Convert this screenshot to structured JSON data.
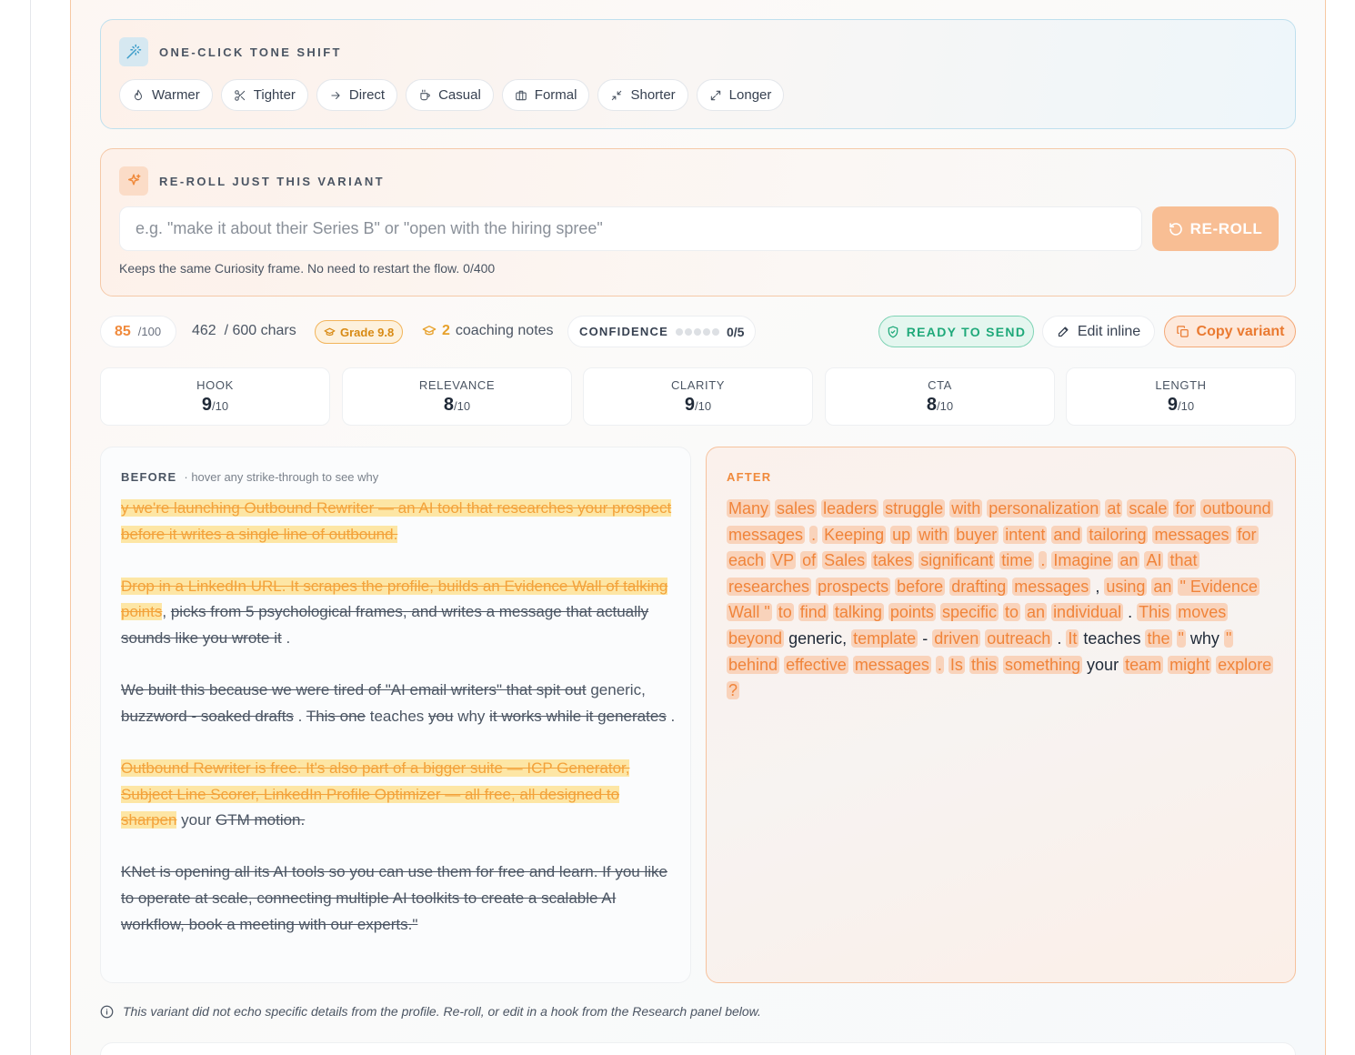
{
  "tone": {
    "title": "ONE-CLICK TONE SHIFT",
    "chips": [
      {
        "label": "Warmer",
        "icon": "flame-icon"
      },
      {
        "label": "Tighter",
        "icon": "scissors-icon"
      },
      {
        "label": "Direct",
        "icon": "arrow-right-icon"
      },
      {
        "label": "Casual",
        "icon": "coffee-icon"
      },
      {
        "label": "Formal",
        "icon": "briefcase-icon"
      },
      {
        "label": "Shorter",
        "icon": "minimize-icon"
      },
      {
        "label": "Longer",
        "icon": "maximize-icon"
      }
    ]
  },
  "reroll": {
    "title": "RE-ROLL JUST THIS VARIANT",
    "placeholder": "e.g. \"make it about their Series B\" or \"open with the hiring spree\"",
    "button": "RE-ROLL",
    "hint": "Keeps the same Curiosity frame. No need to restart the flow. 0/400"
  },
  "stats": {
    "score": "85",
    "score_max": "/100",
    "chars": "462  / 600 chars",
    "grade": "Grade 9.8",
    "coaching_count": "2",
    "coaching_label": "coaching notes",
    "confidence_label": "CONFIDENCE",
    "confidence_value": "0/5",
    "ready": "READY TO SEND",
    "edit": "Edit inline",
    "copy": "Copy variant"
  },
  "metrics": [
    {
      "label": "HOOK",
      "value": "9",
      "max": "/10"
    },
    {
      "label": "RELEVANCE",
      "value": "8",
      "max": "/10"
    },
    {
      "label": "CLARITY",
      "value": "9",
      "max": "/10"
    },
    {
      "label": "CTA",
      "value": "8",
      "max": "/10"
    },
    {
      "label": "LENGTH",
      "value": "9",
      "max": "/10"
    }
  ],
  "before": {
    "title": "BEFORE",
    "subtitle": "· hover any strike-through to see why",
    "p1_hl": "y we're launching Outbound Rewriter — an AI tool that researches your prospect before it writes a single line of outbound.",
    "p2_hl": "Drop in a LinkedIn URL. It scrapes the profile, builds an Evidence Wall of talking points",
    "p2_rest_a": ",",
    "p2_del": "picks from 5 psychological frames, and writes a message that actually sounds like you wrote it",
    "p2_rest_b": ".",
    "p3_del_a": "We built this because we were tired of \"AI email writers\" that spit out",
    "p3_plain_a": "generic,",
    "p3_del_b": "buzzword - soaked drafts",
    "p3_plain_b": ".",
    "p3_del_c": "This one",
    "p3_plain_c": "teaches",
    "p3_del_d": "you",
    "p3_plain_d": "why",
    "p3_del_e": "it works while it generates",
    "p3_plain_e": ".",
    "p4_hl": "Outbound Rewriter is free. It's also part of a bigger suite — ICP Generator, Subject Line Scorer, LinkedIn Profile Optimizer — all free, all designed to sharpen",
    "p4_plain": "your",
    "p4_del": "GTM motion.",
    "p5_del": "KNet is opening all its AI tools so you can use them for free and learn. If you like to operate at scale, connecting multiple AI toolkits to create a scalable AI workflow, book a meeting with our experts.\""
  },
  "after": {
    "title": "AFTER",
    "tokens": [
      {
        "t": "Many",
        "h": true
      },
      {
        "t": "sales",
        "h": true
      },
      {
        "t": "leaders",
        "h": true
      },
      {
        "t": "struggle",
        "h": true
      },
      {
        "t": "with",
        "h": true
      },
      {
        "t": "personalization",
        "h": true
      },
      {
        "t": "at",
        "h": true
      },
      {
        "t": "scale",
        "h": true
      },
      {
        "t": "for",
        "h": true
      },
      {
        "t": "outbound",
        "h": true
      },
      {
        "t": "messages",
        "h": true
      },
      {
        "t": ".",
        "h": true
      },
      {
        "t": "Keeping",
        "h": true
      },
      {
        "t": "up",
        "h": true
      },
      {
        "t": "with",
        "h": true
      },
      {
        "t": "buyer",
        "h": true
      },
      {
        "t": "intent",
        "h": true
      },
      {
        "t": "and",
        "h": true
      },
      {
        "t": "tailoring",
        "h": true
      },
      {
        "t": "messages",
        "h": true
      },
      {
        "t": "for",
        "h": true
      },
      {
        "t": "each",
        "h": true
      },
      {
        "t": "VP",
        "h": true
      },
      {
        "t": "of",
        "h": true
      },
      {
        "t": "Sales",
        "h": true
      },
      {
        "t": "takes",
        "h": true
      },
      {
        "t": "significant",
        "h": true
      },
      {
        "t": "time",
        "h": true
      },
      {
        "t": ".",
        "h": true
      },
      {
        "t": "Imagine",
        "h": true
      },
      {
        "t": "an",
        "h": true
      },
      {
        "t": "AI",
        "h": true
      },
      {
        "t": "that",
        "h": true
      },
      {
        "t": "researches",
        "h": true
      },
      {
        "t": "prospects",
        "h": true
      },
      {
        "t": "before",
        "h": true
      },
      {
        "t": "drafting",
        "h": true
      },
      {
        "t": "messages",
        "h": true
      },
      {
        "t": ",",
        "h": false
      },
      {
        "t": "using",
        "h": true
      },
      {
        "t": "an",
        "h": true
      },
      {
        "t": "\" Evidence",
        "h": true
      },
      {
        "t": "Wall \"",
        "h": true
      },
      {
        "t": "to",
        "h": true
      },
      {
        "t": "find",
        "h": true
      },
      {
        "t": "talking",
        "h": true
      },
      {
        "t": "points",
        "h": true
      },
      {
        "t": "specific",
        "h": true
      },
      {
        "t": "to",
        "h": true
      },
      {
        "t": "an",
        "h": true
      },
      {
        "t": "individual",
        "h": true
      },
      {
        "t": ".",
        "h": false
      },
      {
        "t": "This",
        "h": true
      },
      {
        "t": "moves",
        "h": true
      },
      {
        "t": "beyond",
        "h": true
      },
      {
        "t": "generic,",
        "h": false
      },
      {
        "t": "template",
        "h": true
      },
      {
        "t": "-",
        "h": false
      },
      {
        "t": "driven",
        "h": true
      },
      {
        "t": "outreach",
        "h": true
      },
      {
        "t": ".",
        "h": false
      },
      {
        "t": "It",
        "h": true
      },
      {
        "t": "teaches",
        "h": false
      },
      {
        "t": "the",
        "h": true
      },
      {
        "t": "\"",
        "h": true
      },
      {
        "t": "why",
        "h": false
      },
      {
        "t": "\"",
        "h": true
      },
      {
        "t": "behind",
        "h": true
      },
      {
        "t": "effective",
        "h": true
      },
      {
        "t": "messages",
        "h": true
      },
      {
        "t": ".",
        "h": true
      },
      {
        "t": "Is",
        "h": true
      },
      {
        "t": "this",
        "h": true
      },
      {
        "t": "something",
        "h": true
      },
      {
        "t": "your",
        "h": false
      },
      {
        "t": "team",
        "h": true
      },
      {
        "t": "might",
        "h": true
      },
      {
        "t": "explore",
        "h": true
      },
      {
        "t": "?",
        "h": true
      }
    ]
  },
  "note": "This variant did not echo specific details from the profile. Re-roll, or edit in a hook from the Research panel below.",
  "colors": {
    "accent": "#f08a3c",
    "success": "#1fa97a",
    "highlight": "#fde6a5"
  }
}
